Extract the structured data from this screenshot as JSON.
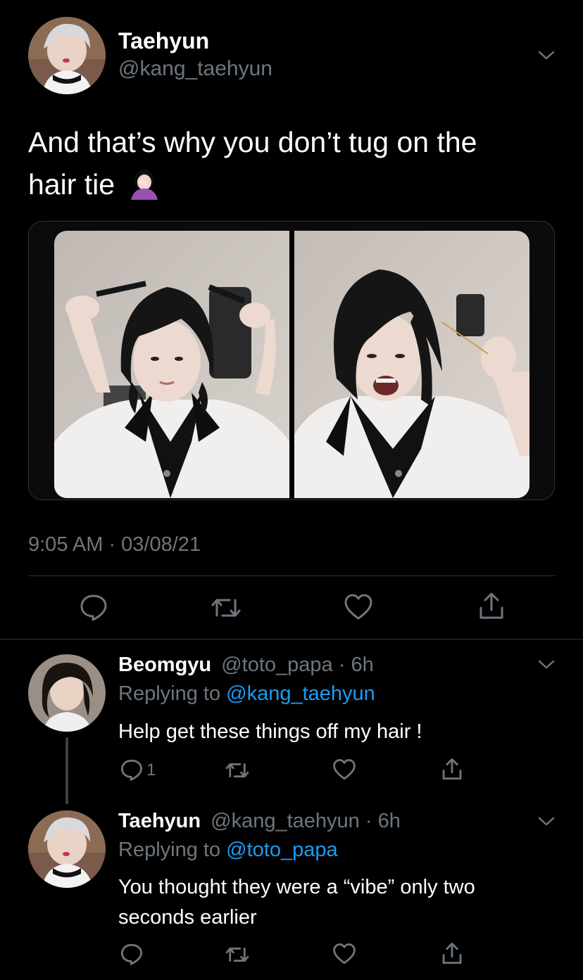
{
  "main_tweet": {
    "author_name": "Taehyun",
    "author_handle": "@kang_taehyun",
    "text_line1": "And that’s why you don’t tug on the",
    "text_line2": "hair tie",
    "emoji": "🤦🏻‍♀️",
    "timestamp": "9:05 AM · 03/08/21",
    "avatar_icon": "avatar-photo",
    "actions": [
      "reply-icon",
      "retweet-icon",
      "like-icon",
      "share-icon"
    ]
  },
  "replies": [
    {
      "author_name": "Beomgyu",
      "author_handle": "@toto_papa",
      "time": "6h",
      "replying_prefix": "Replying to",
      "replying_to": "@kang_taehyun",
      "text_line1": "Help get these things off my hair !",
      "text_line2": "",
      "reply_count": "1"
    },
    {
      "author_name": "Taehyun",
      "author_handle": "@kang_taehyun",
      "time": "6h",
      "replying_prefix": "Replying to",
      "replying_to": "@toto_papa",
      "text_line1": "You thought they were a “vibe” only two",
      "text_line2": "seconds earlier",
      "reply_count": ""
    }
  ],
  "separator": "·",
  "colors": {
    "background": "#000000",
    "secondary_text": "#6e767d",
    "link": "#1d9bf0",
    "divider": "#2f3336"
  }
}
